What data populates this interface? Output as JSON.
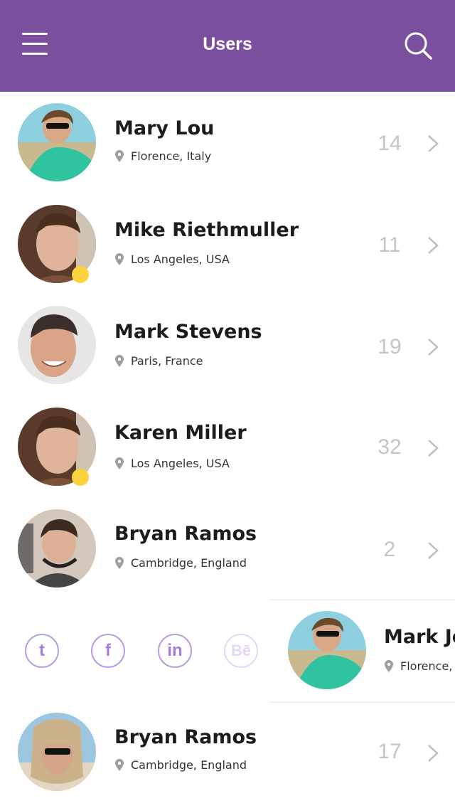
{
  "header": {
    "title": "Users",
    "background": "#7a4f9d"
  },
  "users": [
    {
      "name": "Mary Lou",
      "location": "Florence, Italy",
      "count": "14"
    },
    {
      "name": "Mike Riethmuller",
      "location": "Los Angeles, USA",
      "count": "11",
      "online": true
    },
    {
      "name": "Mark Stevens",
      "location": "Paris, France",
      "count": "19"
    },
    {
      "name": "Karen Miller",
      "location": "Los Angeles, USA",
      "count": "32",
      "online": true
    },
    {
      "name": "Bryan Ramos",
      "location": "Cambridge, England",
      "count": "2"
    },
    {
      "name": "Bryan Ramos",
      "location": "Cambridge, England",
      "count": "17"
    }
  ],
  "swiped_row": {
    "name": "Mark Jo",
    "location": "Florence,",
    "actions": [
      {
        "icon": "twitter-icon",
        "glyph": "t"
      },
      {
        "icon": "facebook-icon",
        "glyph": "f"
      },
      {
        "icon": "linkedin-icon",
        "glyph": "in"
      },
      {
        "icon": "behance-icon",
        "glyph": "Bē"
      }
    ]
  },
  "colors": {
    "accent": "#7a4f9d",
    "online": "#fcd33d",
    "count": "#c5c5c5",
    "social": "#a57fdc"
  }
}
